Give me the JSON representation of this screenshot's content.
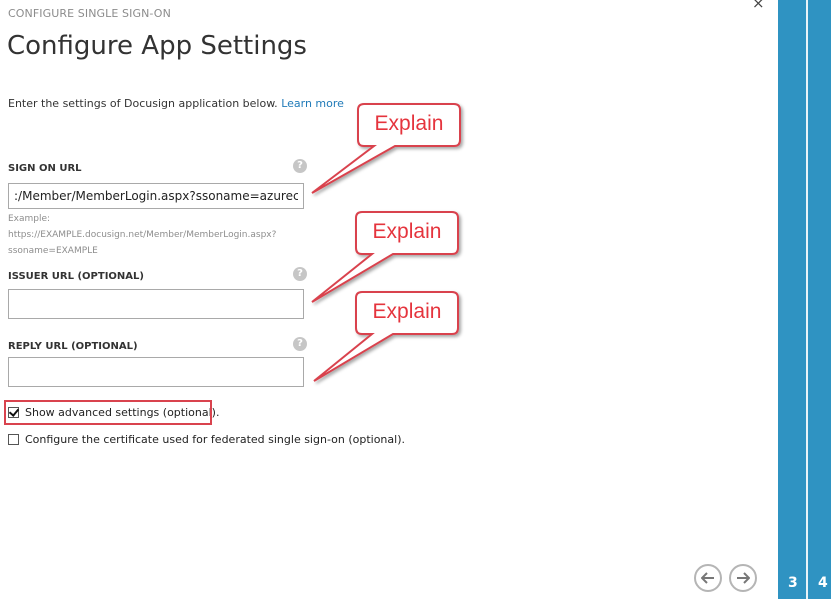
{
  "dialog": {
    "wizard_label": "CONFIGURE SINGLE SIGN-ON",
    "title": "Configure App Settings",
    "intro_text": "Enter the settings of Docusign application below. ",
    "learn_more": "Learn more",
    "close_icon": "×"
  },
  "fields": {
    "sign_on_url": {
      "label": "SIGN ON URL",
      "value": ":/Member/MemberLogin.aspx?ssoname=azurecoe",
      "help": "?",
      "example_lines": [
        "Example:",
        "https://EXAMPLE.docusign.net/Member/MemberLogin.aspx?",
        "ssoname=EXAMPLE"
      ]
    },
    "issuer_url": {
      "label": "ISSUER URL (OPTIONAL)",
      "value": "",
      "help": "?"
    },
    "reply_url": {
      "label": "REPLY URL (OPTIONAL)",
      "value": "",
      "help": "?"
    }
  },
  "checkboxes": {
    "advanced": {
      "label": "Show advanced settings (optional).",
      "checked": true
    },
    "certificate": {
      "label": "Configure the certificate used for federated single sign-on (optional).",
      "checked": false
    }
  },
  "callouts": [
    "Explain",
    "Explain",
    "Explain"
  ],
  "annotation_color": "#e5343d",
  "navigation": {
    "back_icon": "arrow-left-icon",
    "next_icon": "arrow-right-icon"
  },
  "steps": {
    "current": "3",
    "next": "4"
  },
  "colors": {
    "accent": "#2f93c2",
    "link": "#1f7ab8"
  }
}
